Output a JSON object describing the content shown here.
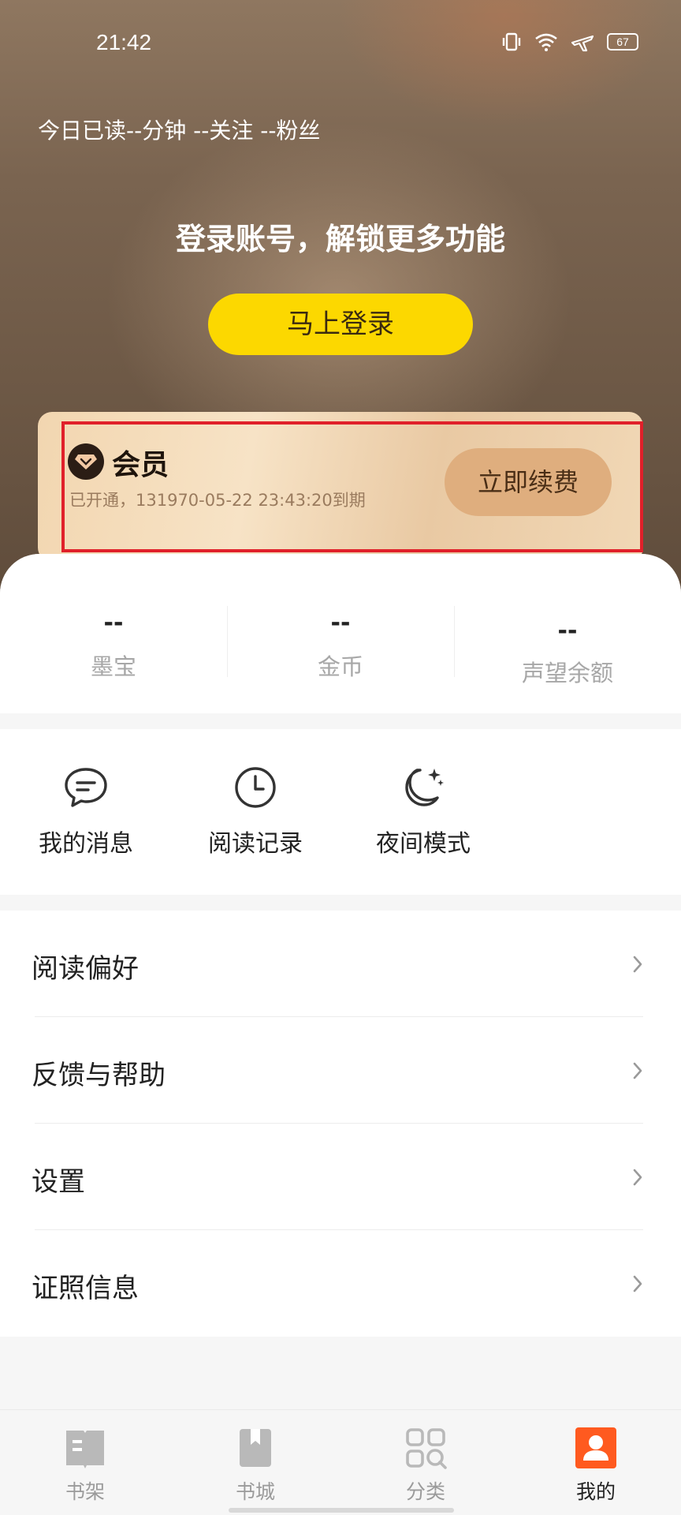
{
  "status_bar": {
    "time": "21:42",
    "battery": "67"
  },
  "header": {
    "reading_stats": "今日已读--分钟 --关注 --粉丝",
    "login_prompt": "登录账号，解锁更多功能",
    "login_button": "马上登录"
  },
  "vip": {
    "title": "会员",
    "subtitle": "已开通，131970-05-22 23:43:20到期",
    "renew_button": "立即续费"
  },
  "stats": [
    {
      "value": "--",
      "label": "墨宝"
    },
    {
      "value": "--",
      "label": "金币"
    },
    {
      "value": "--",
      "label": "声望余额"
    }
  ],
  "shortcuts": [
    {
      "label": "我的消息",
      "icon": "message-icon"
    },
    {
      "label": "阅读记录",
      "icon": "clock-icon"
    },
    {
      "label": "夜间模式",
      "icon": "moon-icon"
    }
  ],
  "menu": [
    {
      "label": "阅读偏好"
    },
    {
      "label": "反馈与帮助"
    },
    {
      "label": "设置"
    },
    {
      "label": "证照信息"
    }
  ],
  "tabs": [
    {
      "label": "书架",
      "icon": "bookshelf-icon",
      "active": false
    },
    {
      "label": "书城",
      "icon": "bookstore-icon",
      "active": false
    },
    {
      "label": "分类",
      "icon": "category-icon",
      "active": false
    },
    {
      "label": "我的",
      "icon": "profile-icon",
      "active": true
    }
  ],
  "colors": {
    "login_button": "#fcd800",
    "renew_button": "#dfae7e",
    "active_tab": "#ff5a1f"
  }
}
